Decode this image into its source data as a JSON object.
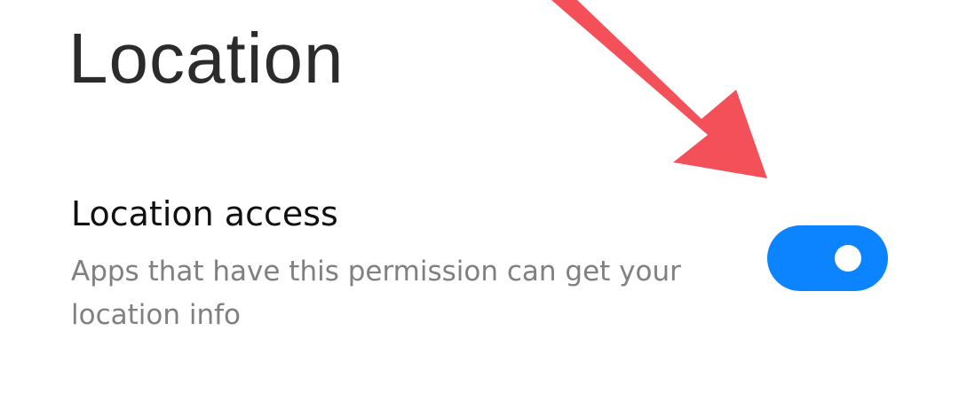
{
  "page": {
    "title": "Location"
  },
  "settings": {
    "location_access": {
      "title": "Location access",
      "description": "Apps that have this permission can get your location info",
      "enabled": true
    }
  },
  "colors": {
    "toggle_on": "#0d84ff",
    "annotation_arrow": "#f4505a"
  },
  "icons": {
    "annotation": "red-arrow-icon"
  }
}
